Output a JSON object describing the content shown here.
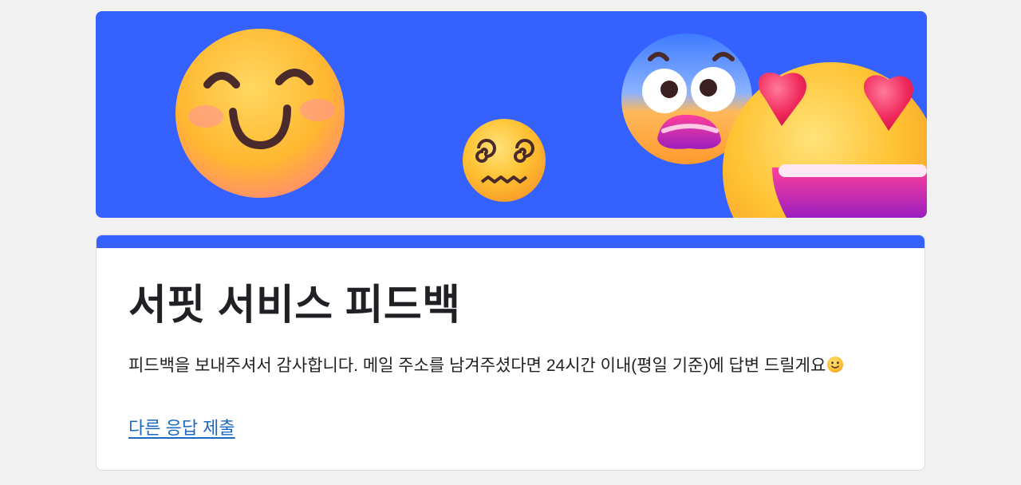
{
  "banner": {
    "background_color": "#3561ff",
    "emojis": [
      "smiling-face-icon",
      "dizzy-face-icon",
      "fearful-face-icon",
      "heart-eyes-face-icon"
    ]
  },
  "form": {
    "accent_color": "#3561ff",
    "title": "서핏 서비스 피드백",
    "description": "피드백을 보내주셔서 감사합니다. 메일 주소를 남겨주셨다면 24시간 이내(평일 기준)에 답변 드릴게요",
    "description_emoji": "slightly-smiling-face-icon",
    "another_response_link": "다른 응답 제출",
    "link_color": "#1a67c4"
  }
}
